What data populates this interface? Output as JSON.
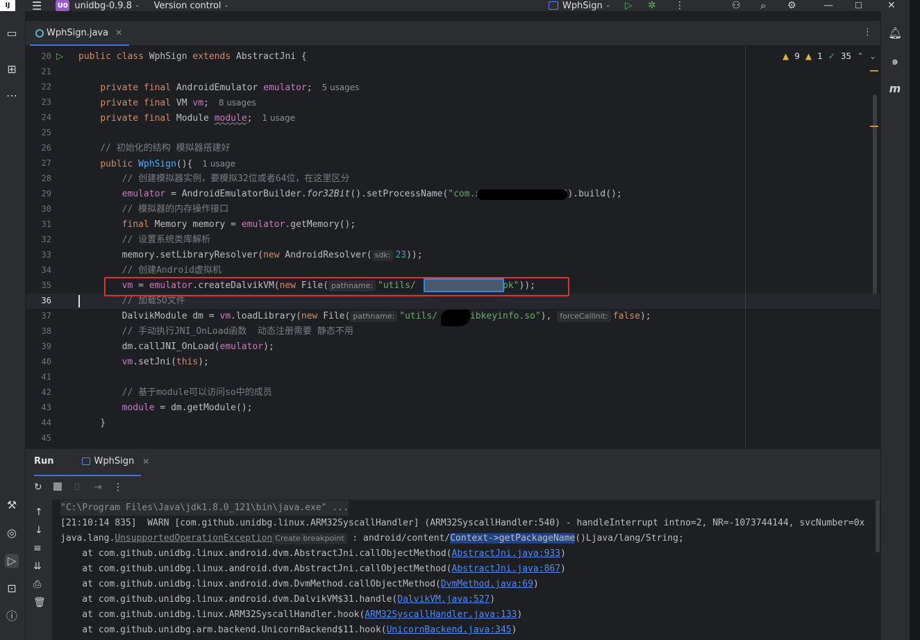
{
  "titlebar": {
    "logo": "IJ",
    "project_badge": "U0",
    "project_name": "unidbg-0.9.8",
    "vcs": "Version control",
    "run_config": "WphSign"
  },
  "tabs": [
    {
      "label": "WphSign.java",
      "close": "✕"
    }
  ],
  "inspections": {
    "warnings": "9",
    "errors": "1",
    "ok": "35"
  },
  "editor": {
    "lines": [
      {
        "n": "20"
      },
      {
        "n": "21"
      },
      {
        "n": "22"
      },
      {
        "n": "23"
      },
      {
        "n": "24"
      },
      {
        "n": "25"
      },
      {
        "n": "26"
      },
      {
        "n": "27"
      },
      {
        "n": "28"
      },
      {
        "n": "29"
      },
      {
        "n": "30"
      },
      {
        "n": "31"
      },
      {
        "n": "32"
      },
      {
        "n": "33"
      },
      {
        "n": "34"
      },
      {
        "n": "35"
      },
      {
        "n": "36"
      },
      {
        "n": "37"
      },
      {
        "n": "38"
      },
      {
        "n": "39"
      },
      {
        "n": "40"
      },
      {
        "n": "41"
      },
      {
        "n": "42"
      },
      {
        "n": "43"
      },
      {
        "n": "44"
      },
      {
        "n": "45"
      }
    ],
    "usage_5": "5 usages",
    "usage_8": "8 usages",
    "usage_1a": "1 usage",
    "usage_1b": "1 usage",
    "c26": "// 初始化的结构 模拟器搭建好",
    "c28": "// 创建模拟器实例，要模拟32位或者64位，在这里区分",
    "c30": "// 模拟器的内存操作接口",
    "c32": "// 设置系统类库解析",
    "c34": "// 创建Android虚拟机",
    "c36": "// 加载SO文件",
    "c38": "// 手动执行JNI_OnLoad函数  动态注册需要 静态不用",
    "c42": "// 基于module可以访问so中的成员",
    "hint_sdk": "sdk:",
    "hint_pathname": "pathname:",
    "hint_pathname2": "pathname:",
    "hint_forcecallinit": "forceCallInit:"
  },
  "run": {
    "label": "Run",
    "tab": "WphSign",
    "console": {
      "l1": "\"C:\\Program Files\\Java\\jdk1.8.0_121\\bin\\java.exe\" ...",
      "l2": "[21:10:14 835]  WARN [com.github.unidbg.linux.ARM32SyscallHandler] (ARM32SyscallHandler:540) - handleInterrupt intno=2, NR=-1073744144, svcNumber=0x",
      "l3a": "java.lang.",
      "l3b": "UnsupportedOperationException",
      "l3c": "Create breakpoint",
      "l3d": " : android/content/",
      "l3e": "Context->getPackageName",
      "l3f": "()Ljava/lang/String;",
      "traces": [
        {
          "pre": "    at com.github.unidbg.linux.android.dvm.AbstractJni.callObjectMethod(",
          "link": "AbstractJni.java:933",
          "post": ")"
        },
        {
          "pre": "    at com.github.unidbg.linux.android.dvm.AbstractJni.callObjectMethod(",
          "link": "AbstractJni.java:867",
          "post": ")"
        },
        {
          "pre": "    at com.github.unidbg.linux.android.dvm.DvmMethod.callObjectMethod(",
          "link": "DvmMethod.java:69",
          "post": ")"
        },
        {
          "pre": "    at com.github.unidbg.linux.android.dvm.DalvikVM$31.handle(",
          "link": "DalvikVM.java:527",
          "post": ")"
        },
        {
          "pre": "    at com.github.unidbg.linux.ARM32SyscallHandler.hook(",
          "link": "ARM32SyscallHandler.java:133",
          "post": ")"
        },
        {
          "pre": "    at com.github.unidbg.arm.backend.UnicornBackend$11.hook(",
          "link": "UnicornBackend.java:345",
          "post": ")"
        }
      ]
    }
  },
  "colors": {
    "accent": "#3574f0",
    "highlight_box": "#e0312a",
    "selection_box": "#2d8ae8"
  }
}
